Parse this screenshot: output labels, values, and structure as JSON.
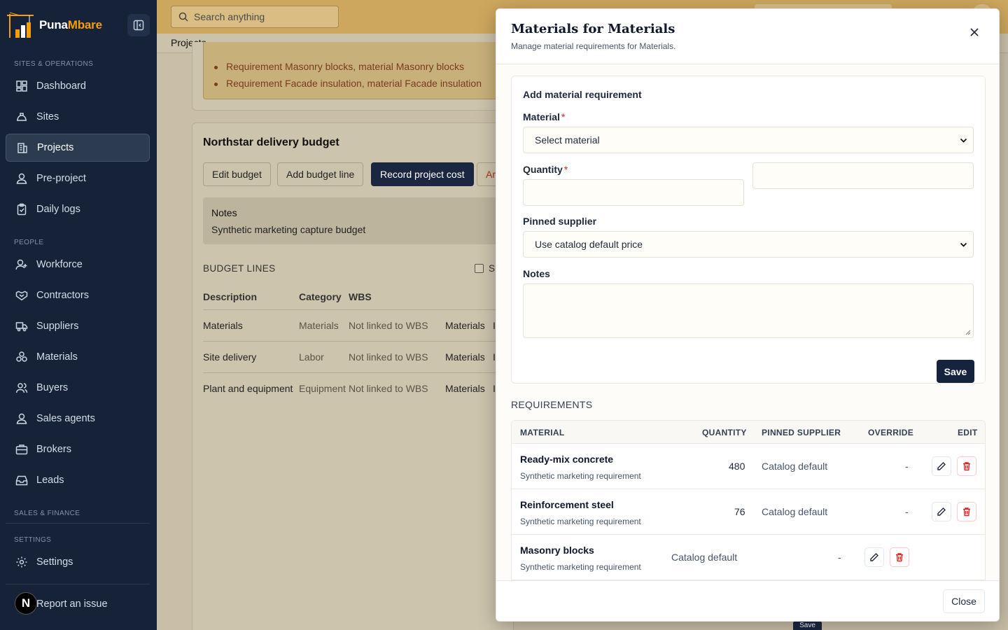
{
  "brand": {
    "name_part1": "Puna",
    "name_part2": "Mbare"
  },
  "sidebar": {
    "sections": [
      "SITES & OPERATIONS",
      "PEOPLE",
      "SALES & FINANCE",
      "SETTINGS"
    ],
    "items": [
      {
        "label": "Dashboard",
        "icon": "dashboard-icon"
      },
      {
        "label": "Sites",
        "icon": "hardhat-icon"
      },
      {
        "label": "Projects",
        "icon": "building-icon",
        "active": true
      },
      {
        "label": "Pre-project",
        "icon": "user-icon"
      },
      {
        "label": "Daily logs",
        "icon": "clipboard-icon"
      },
      {
        "label": "Workforce",
        "icon": "user-plus-icon"
      },
      {
        "label": "Contractors",
        "icon": "handshake-icon"
      },
      {
        "label": "Suppliers",
        "icon": "truck-icon"
      },
      {
        "label": "Materials",
        "icon": "boxes-icon"
      },
      {
        "label": "Buyers",
        "icon": "users-icon"
      },
      {
        "label": "Sales agents",
        "icon": "user-icon"
      },
      {
        "label": "Brokers",
        "icon": "briefcase-icon"
      },
      {
        "label": "Leads",
        "icon": "inbox-icon"
      },
      {
        "label": "Settings",
        "icon": "gear-icon"
      }
    ],
    "avatar_letter": "N",
    "report_issue": "Report an issue"
  },
  "topbar": {
    "search_placeholder": "Search anything"
  },
  "breadcrumb": "Projects",
  "background": {
    "warnings": [
      "Requirement Masonry blocks, material Masonry blocks",
      "Requirement Facade insulation, material Facade insulation"
    ],
    "budget_title": "Northstar delivery budget",
    "buttons": [
      "Edit budget",
      "Add budget line",
      "Record project cost",
      "Ar"
    ],
    "notes_label": "Notes",
    "notes_text": "Synthetic marketing capture budget",
    "budget_lines_label": "BUDGET LINES",
    "checkbox_label": "S",
    "columns": [
      "Description",
      "Category",
      "WBS"
    ],
    "rows": [
      {
        "description": "Materials",
        "category": "Materials",
        "wbs": "Not linked to WBS",
        "extra": "Materials",
        "trail": "I"
      },
      {
        "description": "Site delivery",
        "category": "Labor",
        "wbs": "Not linked to WBS",
        "extra": "Materials",
        "trail": "I"
      },
      {
        "description": "Plant and equipment",
        "category": "Equipment",
        "wbs": "Not linked to WBS",
        "extra": "Materials",
        "trail": "I"
      }
    ],
    "save_label": "Save"
  },
  "modal": {
    "title": "Materials for Materials",
    "subtitle": "Manage material requirements for Materials.",
    "form": {
      "heading": "Add material requirement",
      "material_label": "Material",
      "material_value": "Select material",
      "quantity_label": "Quantity",
      "quantity_value": "",
      "unit_value": "",
      "pinned_label": "Pinned supplier",
      "pinned_value": "Use catalog default price",
      "notes_label": "Notes",
      "notes_value": "",
      "save_label": "Save",
      "required_mark": "*"
    },
    "requirements_label": "REQUIREMENTS",
    "table": {
      "headers": [
        "MATERIAL",
        "QUANTITY",
        "PINNED SUPPLIER",
        "OVERRIDE",
        "EDIT"
      ],
      "rows": [
        {
          "name": "Ready-mix concrete",
          "desc": "Synthetic marketing requirement",
          "quantity": "480",
          "supplier": "Catalog default",
          "override": "-"
        },
        {
          "name": "Reinforcement steel",
          "desc": "Synthetic marketing requirement",
          "quantity": "76",
          "supplier": "Catalog default",
          "override": "-"
        },
        {
          "name": "Masonry blocks",
          "desc": "Synthetic marketing requirement",
          "quantity": "",
          "supplier": "Catalog default",
          "override": "-"
        }
      ]
    },
    "close_label": "Close"
  }
}
